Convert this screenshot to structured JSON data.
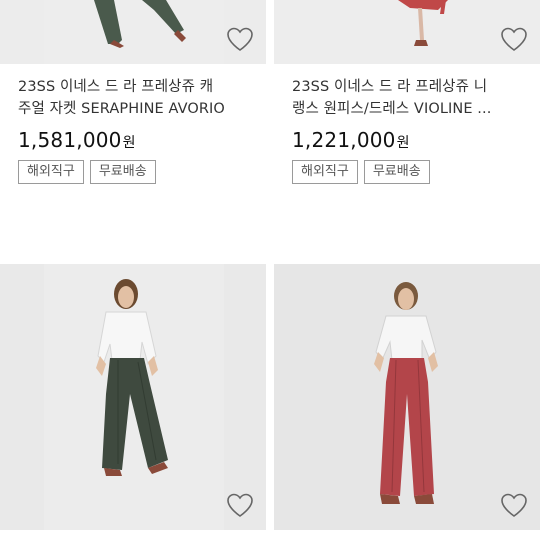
{
  "products": [
    {
      "title_line1": "23SS 이네스 드 라 프레상쥬 캐",
      "title_line2": "주얼 자켓 SERAPHINE AVORIO",
      "price": "1,581,000",
      "currency": "원",
      "badges": [
        "해외직구",
        "무료배송"
      ],
      "icon": "heart-outline-icon"
    },
    {
      "title_line1": "23SS 이네스 드 라 프레상쥬 니",
      "title_line2": "랭스 원피스/드레스 VIOLINE ...",
      "price": "1,221,000",
      "currency": "원",
      "badges": [
        "해외직구",
        "무료배송"
      ],
      "icon": "heart-outline-icon"
    },
    {
      "icon": "heart-outline-icon",
      "pants_color": "#3f4a3f"
    },
    {
      "icon": "heart-outline-icon",
      "pants_color": "#b3454a"
    }
  ]
}
